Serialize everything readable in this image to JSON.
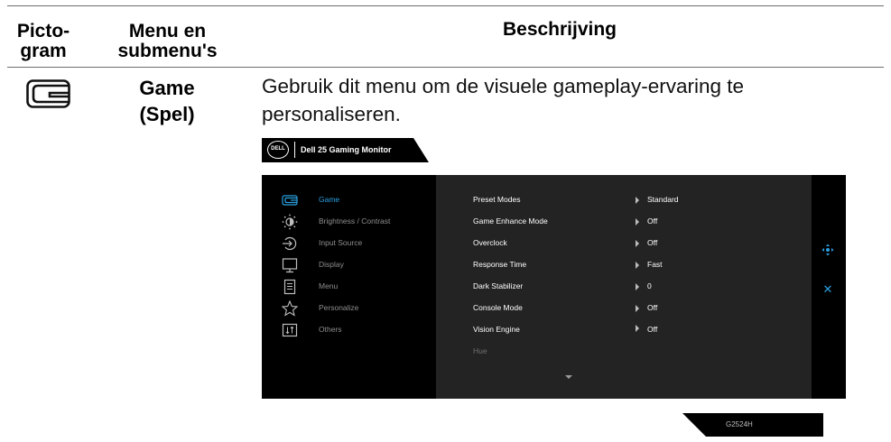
{
  "table": {
    "headers": {
      "pictogram_line1": "Picto-",
      "pictogram_line2": "gram",
      "menu_line1": "Menu en",
      "menu_line2": "submenu's",
      "description": "Beschrijving"
    },
    "row": {
      "pictogram_icon": "game-icon",
      "menu_line1": "Game",
      "menu_line2": "(Spel)",
      "description": "Gebruik dit menu om de visuele gameplay-ervaring te personaliseren."
    }
  },
  "osd": {
    "brand_logo": "DELL",
    "title": "Dell 25 Gaming Monitor",
    "accent_color": "#2a9fe0",
    "menu": [
      {
        "label": "Game",
        "icon": "game-icon",
        "active": true
      },
      {
        "label": "Brightness / Contrast",
        "icon": "brightness-icon",
        "active": false
      },
      {
        "label": "Input Source",
        "icon": "input-source-icon",
        "active": false
      },
      {
        "label": "Display",
        "icon": "display-icon",
        "active": false
      },
      {
        "label": "Menu",
        "icon": "menu-icon",
        "active": false
      },
      {
        "label": "Personalize",
        "icon": "star-icon",
        "active": false
      },
      {
        "label": "Others",
        "icon": "others-icon",
        "active": false
      }
    ],
    "settings": [
      {
        "label": "Preset Modes",
        "value": "Standard"
      },
      {
        "label": "Game Enhance Mode",
        "value": "Off"
      },
      {
        "label": "Overclock",
        "value": "Off"
      },
      {
        "label": "Response Time",
        "value": "Fast"
      },
      {
        "label": "Dark Stabilizer",
        "value": "0"
      },
      {
        "label": "Console Mode",
        "value": "Off"
      },
      {
        "label": "Vision Engine",
        "value": "Off"
      },
      {
        "label": "Hue",
        "value": ""
      }
    ],
    "side_icons": [
      "navigate-icon",
      "close-icon"
    ],
    "model": "G2524H"
  }
}
